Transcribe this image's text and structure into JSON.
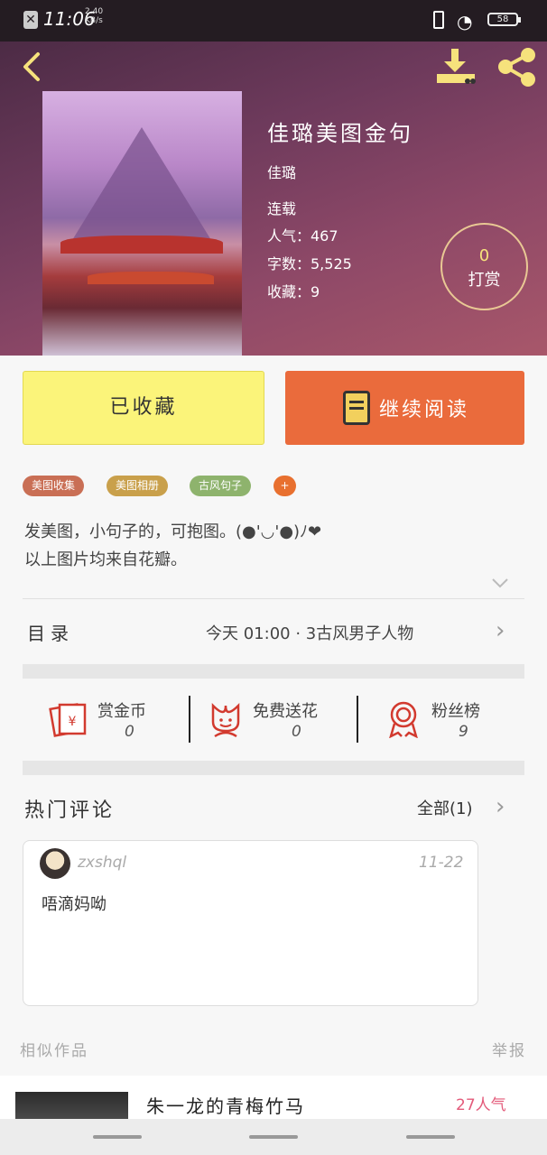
{
  "status": {
    "time": "11:06",
    "speed": "2.40\nKB/s",
    "battery": "58"
  },
  "book": {
    "title": "佳璐美图金句",
    "author": "佳璐",
    "state": "连载",
    "popularity": "人气：467",
    "words": "字数：5,525",
    "collects": "收藏：9"
  },
  "reward": {
    "count": "0",
    "label": "打赏"
  },
  "buttons": {
    "collected": "已收藏",
    "continue": "继续阅读"
  },
  "tags": [
    {
      "label": "美图收集",
      "color": "#c96f55"
    },
    {
      "label": "美图相册",
      "color": "#c9a04b"
    },
    {
      "label": "古风句子",
      "color": "#8eb36d"
    },
    {
      "label": "+",
      "color": "#e8702f"
    }
  ],
  "description": {
    "line1": "发美图，小句子的，可抱图。(●'◡'●)ﾉ❤",
    "line2": "以上图片均来自花瓣。"
  },
  "toc": {
    "label": "目录",
    "latest": "今天  01:00 · 3古风男子人物"
  },
  "stats": [
    {
      "label": "赏金币",
      "value": "0"
    },
    {
      "label": "免费送花",
      "value": "0"
    },
    {
      "label": "粉丝榜",
      "value": "9"
    }
  ],
  "comments": {
    "title": "热门评论",
    "all": "全部(1)",
    "items": [
      {
        "user": "zxshql",
        "date": "11-22",
        "text": "唔滴妈呦"
      }
    ]
  },
  "similar": {
    "title": "相似作品",
    "report": "举报"
  },
  "similar_item": {
    "title": "朱一龙的青梅竹马",
    "popularity": "27人气"
  },
  "colors": {
    "accent": "#ea6b3c",
    "favorite": "#fbf47a",
    "icon_yellow": "#f6e27c"
  }
}
